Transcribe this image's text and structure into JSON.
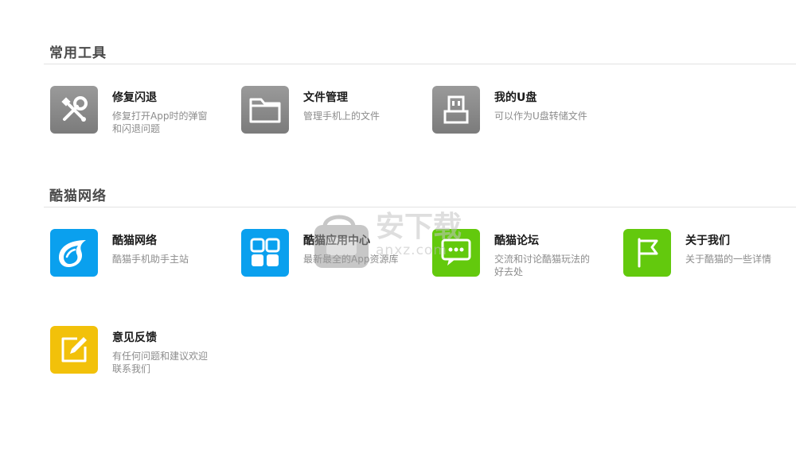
{
  "sections": [
    {
      "title": "常用工具",
      "items": [
        {
          "name": "修复闪退",
          "desc": "修复打开App时的弹窗和闪退问题",
          "icon": "wrench-screwdriver-icon"
        },
        {
          "name": "文件管理",
          "desc": "管理手机上的文件",
          "icon": "folder-icon"
        },
        {
          "name": "我的U盘",
          "desc": "可以作为U盘转储文件",
          "icon": "usb-drive-icon"
        }
      ]
    },
    {
      "title": "酷猫网络",
      "items": [
        {
          "name": "酷猫网络",
          "desc": "酷猫手机助手主站",
          "icon": "water-drop-logo-icon"
        },
        {
          "name": "酷猫应用中心",
          "desc": "最新最全的App资源库",
          "icon": "app-grid-icon"
        },
        {
          "name": "酷猫论坛",
          "desc": "交流和讨论酷猫玩法的好去处",
          "icon": "forum-chat-icon"
        },
        {
          "name": "关于我们",
          "desc": "关于酷猫的一些详情",
          "icon": "flag-icon"
        },
        {
          "name": "意见反馈",
          "desc": "有任何问题和建议欢迎联系我们",
          "icon": "edit-note-icon"
        }
      ]
    }
  ],
  "watermark": {
    "text": "anxz.com",
    "logo_text": "安下载"
  },
  "colors": {
    "gray": "#8a8a8a",
    "blue": "#0aa0ee",
    "green": "#63c90d",
    "yellow": "#f2c10a"
  }
}
